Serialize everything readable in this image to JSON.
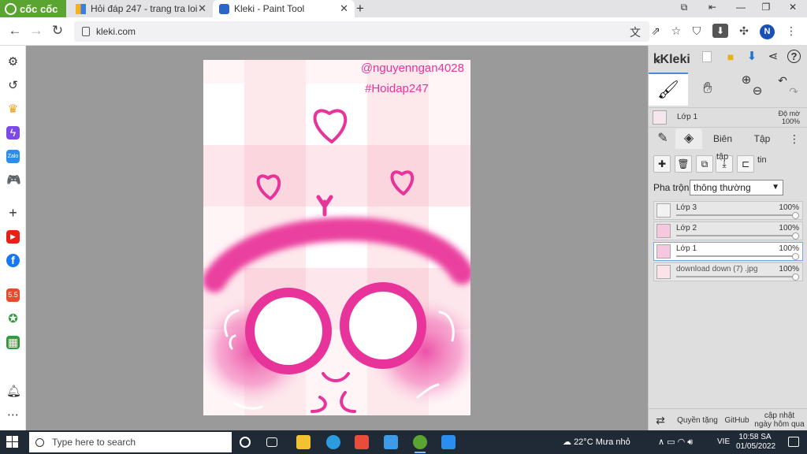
{
  "browser": {
    "brand": "cốc cốc",
    "tabs": [
      {
        "title": "Hỏi đáp 247 - trang tra loi",
        "active": false
      },
      {
        "title": "Kleki - Paint Tool",
        "active": true
      }
    ],
    "url": "kleki.com",
    "profile_initial": "N"
  },
  "canvas": {
    "credit_user": "@nguyenngan4028",
    "credit_tag": "#Hoidap247",
    "accent": "#e8349a"
  },
  "panel": {
    "app_name": "Kleki",
    "current_layer": "Lớp 1",
    "opacity_label": "Độ mờ",
    "opacity_value": "100%",
    "tabs": [
      "Biên",
      "Tập"
    ],
    "action_captions": [
      "tập",
      "tin"
    ],
    "blend_label": "Pha trộn",
    "blend_value": "thông thường",
    "layers": [
      {
        "name": "Lớp 3",
        "opacity": "100%",
        "active": false
      },
      {
        "name": "Lớp 2",
        "opacity": "100%",
        "active": false
      },
      {
        "name": "Lớp 1",
        "opacity": "100%",
        "active": true
      },
      {
        "name": "download down (7) .jpg",
        "opacity": "100%",
        "active": false
      }
    ],
    "footer": {
      "copyright": "Quyền tặng",
      "github": "GitHub",
      "update_line1": "cập nhật",
      "update_line2": "ngày hôm qua"
    }
  },
  "taskbar": {
    "search_placeholder": "Type here to search",
    "temperature": "22°C",
    "weather": "Mưa nhỏ",
    "language": "VIE",
    "time": "10:58 SA",
    "date": "01/05/2022"
  }
}
